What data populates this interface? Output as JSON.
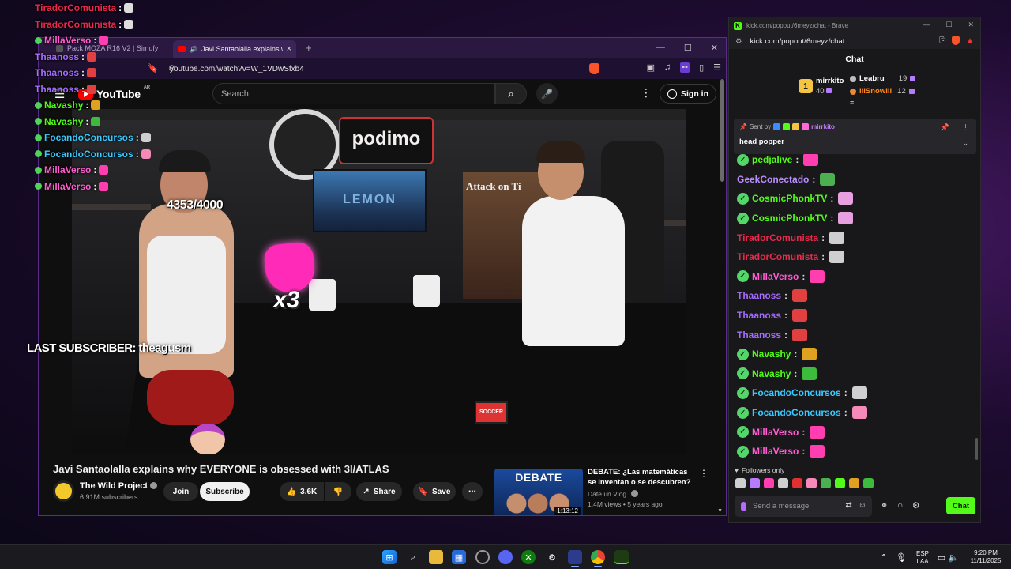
{
  "overlay_chat": [
    {
      "user": "TiradorComunista",
      "verified": false,
      "color": "#e8294a",
      "emote": "#ddd"
    },
    {
      "user": "TiradorComunista",
      "verified": false,
      "color": "#e8294a",
      "emote": "#ddd"
    },
    {
      "user": "MillaVerso",
      "verified": true,
      "color": "#ff5cd1",
      "emote": "#ff3fb0"
    },
    {
      "user": "Thaanoss",
      "verified": false,
      "color": "#a56bff",
      "emote": "#e04040"
    },
    {
      "user": "Thaanoss",
      "verified": false,
      "color": "#a56bff",
      "emote": "#e04040"
    },
    {
      "user": "Thaanoss",
      "verified": false,
      "color": "#a56bff",
      "emote": "#e04040"
    },
    {
      "user": "Navashy",
      "verified": true,
      "color": "#53fc18",
      "emote": "#e0a020"
    },
    {
      "user": "Navashy",
      "verified": true,
      "color": "#53fc18",
      "emote": "#3dbb3d"
    },
    {
      "user": "FocandoConcursos",
      "verified": true,
      "color": "#39c9ff",
      "emote": "#cfcfcf"
    },
    {
      "user": "FocandoConcursos",
      "verified": true,
      "color": "#39c9ff",
      "emote": "#f58ab8"
    },
    {
      "user": "MillaVerso",
      "verified": true,
      "color": "#ff5cd1",
      "emote": "#ff3fb0"
    },
    {
      "user": "MillaVerso",
      "verified": true,
      "color": "#ff5cd1",
      "emote": "#ff3fb0"
    }
  ],
  "browser": {
    "inactive_tab": "Pack MOZA R16 V2 | Simufy",
    "active_tab": "Javi Santaolalla explains why E",
    "tab_close": "×",
    "new_tab": "+",
    "url": "youtube.com/watch?v=W_1VDwSfxb4"
  },
  "youtube": {
    "logo": "YouTube",
    "region": "AR",
    "search_placeholder": "Search",
    "signin": "Sign in",
    "overlay_goal": "4353/4000",
    "overlay_multiplier": "x3",
    "overlay_last_subscriber": "LAST SUBSCRIBER: theagusm",
    "video_sign_podimo": "podimo",
    "video_sign_monitor": "LEMON",
    "video_sign_poster": "Attack on Ti",
    "video_sign_soccer": "SOCCER",
    "video_title": "Javi Santaolalla explains why EVERYONE is obsessed with 3I/ATLAS",
    "channel_name": "The Wild Project",
    "channel_subs": "6.91M subscribers",
    "join": "Join",
    "subscribe": "Subscribe",
    "likes": "3.6K",
    "share": "Share",
    "save": "Save",
    "reco": {
      "thumb_title": "DEBATE",
      "duration": "1:13:12",
      "title": "DEBATE: ¿Las matemáticas se inventan o se descubren?",
      "channel": "Date un Vlog",
      "meta": "1.4M views • 5 years ago"
    }
  },
  "kick": {
    "window_title": "kick.com/popout/6meyz/chat - Brave",
    "url": "kick.com/popout/6meyz/chat",
    "header": "Chat",
    "leaderboard": [
      {
        "rank": "1",
        "name": "mirrkito",
        "count": "40"
      },
      {
        "rank": "2",
        "name": "Leabru",
        "count": "19"
      },
      {
        "rank": "3",
        "name": "lllSnowlll",
        "count": "12"
      }
    ],
    "pinned": {
      "sent_by_label": "Sent by",
      "user": "mirrkito",
      "message": "head popper"
    },
    "messages": [
      {
        "user": "pedjalive",
        "verified": true,
        "color": "#53fc18",
        "emote": "#ff3fb0"
      },
      {
        "user": "GeekConectado",
        "verified": false,
        "color": "#b98cff",
        "emote": "#4caf50"
      },
      {
        "user": "CosmicPhonkTV",
        "verified": true,
        "color": "#53fc18",
        "emote": "#e6a0e0"
      },
      {
        "user": "CosmicPhonkTV",
        "verified": true,
        "color": "#53fc18",
        "emote": "#e6a0e0"
      },
      {
        "user": "TiradorComunista",
        "verified": false,
        "color": "#e8294a",
        "emote": "#cfcfcf"
      },
      {
        "user": "TiradorComunista",
        "verified": false,
        "color": "#e8294a",
        "emote": "#cfcfcf"
      },
      {
        "user": "MillaVerso",
        "verified": true,
        "color": "#ff5cd1",
        "emote": "#ff3fb0"
      },
      {
        "user": "Thaanoss",
        "verified": false,
        "color": "#a56bff",
        "emote": "#e04040"
      },
      {
        "user": "Thaanoss",
        "verified": false,
        "color": "#a56bff",
        "emote": "#e04040"
      },
      {
        "user": "Thaanoss",
        "verified": false,
        "color": "#a56bff",
        "emote": "#e04040"
      },
      {
        "user": "Navashy",
        "verified": true,
        "color": "#53fc18",
        "emote": "#e0a020"
      },
      {
        "user": "Navashy",
        "verified": true,
        "color": "#53fc18",
        "emote": "#3dbb3d"
      },
      {
        "user": "FocandoConcursos",
        "verified": true,
        "color": "#39c9ff",
        "emote": "#cfcfcf"
      },
      {
        "user": "FocandoConcursos",
        "verified": true,
        "color": "#39c9ff",
        "emote": "#f58ab8"
      },
      {
        "user": "MillaVerso",
        "verified": true,
        "color": "#ff5cd1",
        "emote": "#ff3fb0"
      },
      {
        "user": "MillaVerso",
        "verified": true,
        "color": "#ff5cd1",
        "emote": "#ff3fb0"
      }
    ],
    "followers_only": "Followers only",
    "input_placeholder": "Send a message",
    "chat_button": "Chat",
    "emote_strip": [
      "#cfcfcf",
      "#b77bff",
      "#ff3fb0",
      "#cfcfcf",
      "#e03030",
      "#f58ab8",
      "#4caf50",
      "#53fc18",
      "#e0a020",
      "#3dbb3d"
    ]
  },
  "taskbar": {
    "lang_top": "ESP",
    "lang_bottom": "LAA",
    "time": "9:20 PM",
    "date": "11/11/2025"
  },
  "colors": {
    "kick_green": "#53fc18",
    "youtube_red": "#ff0000",
    "brave_orange": "#fb542b"
  }
}
